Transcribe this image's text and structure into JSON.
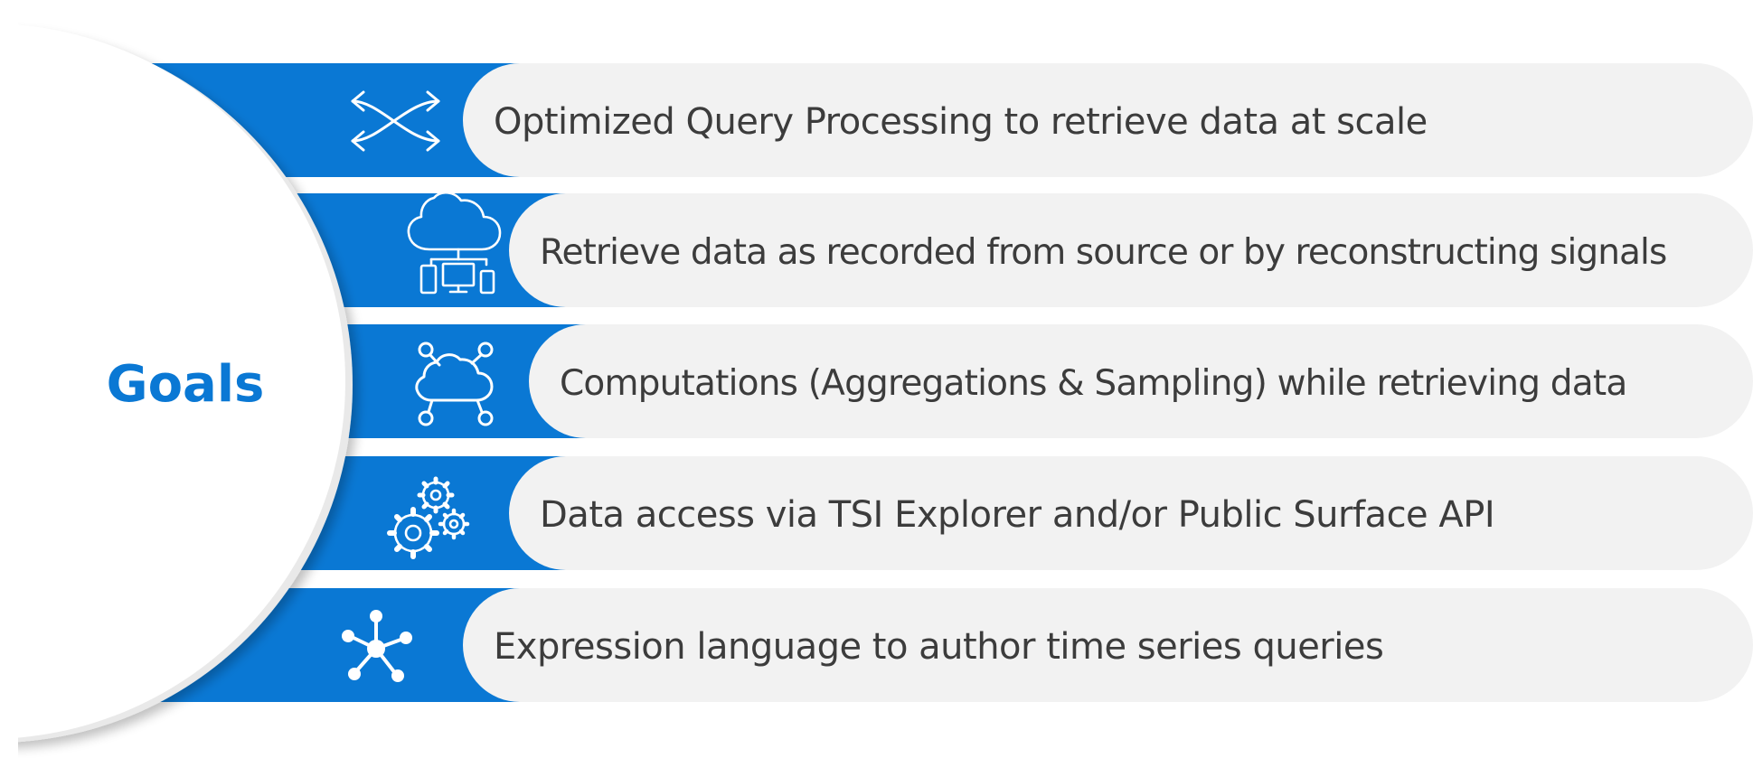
{
  "center": {
    "title": "Goals"
  },
  "rows": [
    {
      "icon": "shuffle-arrows-icon",
      "text": "Optimized Query Processing to retrieve data at scale"
    },
    {
      "icon": "cloud-devices-icon",
      "text": "Retrieve data as recorded from source or by reconstructing signals"
    },
    {
      "icon": "cloud-network-icon",
      "text": "Computations (Aggregations & Sampling) while retrieving data"
    },
    {
      "icon": "gears-icon",
      "text": "Data access via TSI Explorer and/or Public Surface API"
    },
    {
      "icon": "hub-nodes-icon",
      "text": "Expression language to author time series queries"
    }
  ],
  "colors": {
    "accent": "#0a78d4",
    "pill": "#f2f2f2",
    "text": "#3c3c3c",
    "circle_shadow": "#e6e6e6"
  }
}
